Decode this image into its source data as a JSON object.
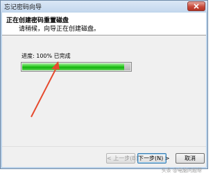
{
  "window": {
    "title": "忘记密码向导",
    "close_icon": "close-icon"
  },
  "header": {
    "title": "正在创建密码重置磁盘",
    "subtitle": "请稍候，向导正在创建磁盘。"
  },
  "progress": {
    "label": "进度: 100% 已完成",
    "value": 1.0,
    "fill_color": "#22c41a"
  },
  "annotation": {
    "arrow_color": "#e64a2e"
  },
  "buttons": {
    "back": "< 上一步(B)",
    "next": "下一步(N) >",
    "cancel": "取消"
  },
  "watermark": {
    "text": "头条 @电脑问题帮"
  }
}
